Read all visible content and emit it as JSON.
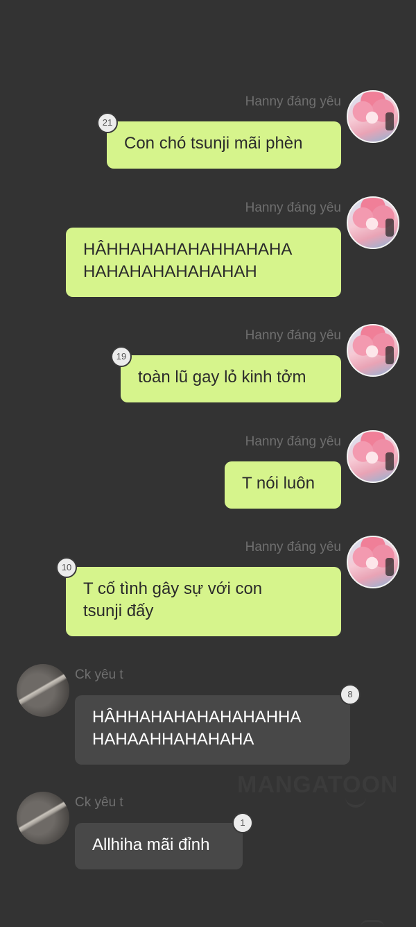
{
  "app": {
    "watermark": "MANGATOON"
  },
  "messages": [
    {
      "sender": "Hanny đáng yêu",
      "text": "Con chó tsunji mãi phèn",
      "badge": "21"
    },
    {
      "sender": "Hanny đáng yêu",
      "text_lines": [
        "HÂHHAHAHAHAHHAHAHA",
        "HAHAHAHAHAHAHAH"
      ]
    },
    {
      "sender": "Hanny đáng yêu",
      "text": "toàn lũ gay lỏ kinh tởm",
      "badge": "19"
    },
    {
      "sender": "Hanny đáng yêu",
      "text": "T nói luôn"
    },
    {
      "sender": "Hanny đáng yêu",
      "text_lines": [
        "T cố tình gây sự với con",
        "tsunji đấy"
      ],
      "badge": "10"
    },
    {
      "sender": "Ck yêu t",
      "text_lines": [
        "HÂHHAHAHAHAHAHAHHA",
        "HAHAAHHAHAHAHA"
      ],
      "badge": "8"
    },
    {
      "sender": "Ck yêu t",
      "text": "Allhiha mãi đỉnh",
      "badge": "1"
    }
  ]
}
